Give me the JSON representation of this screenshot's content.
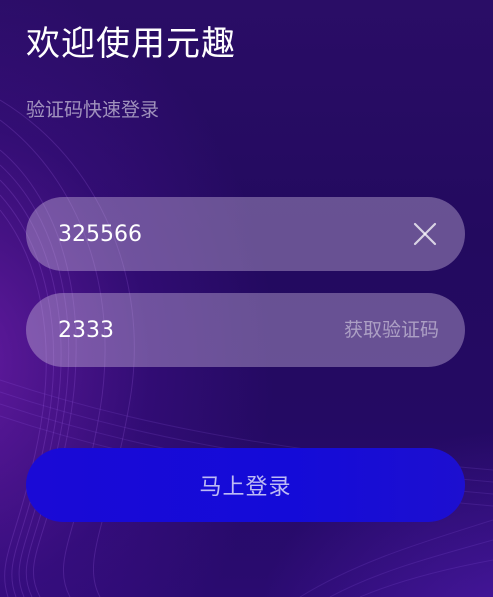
{
  "header": {
    "title": "欢迎使用元趣",
    "subtitle": "验证码快速登录"
  },
  "form": {
    "phone_value": "325566",
    "code_value": "2333",
    "get_code_label": "获取验证码",
    "login_label": "马上登录"
  },
  "icons": {
    "clear": "close-icon"
  },
  "colors": {
    "background": "#230a5f",
    "field_bg": "#8a79b0",
    "button": "#140bd8",
    "text": "#ffffff"
  }
}
